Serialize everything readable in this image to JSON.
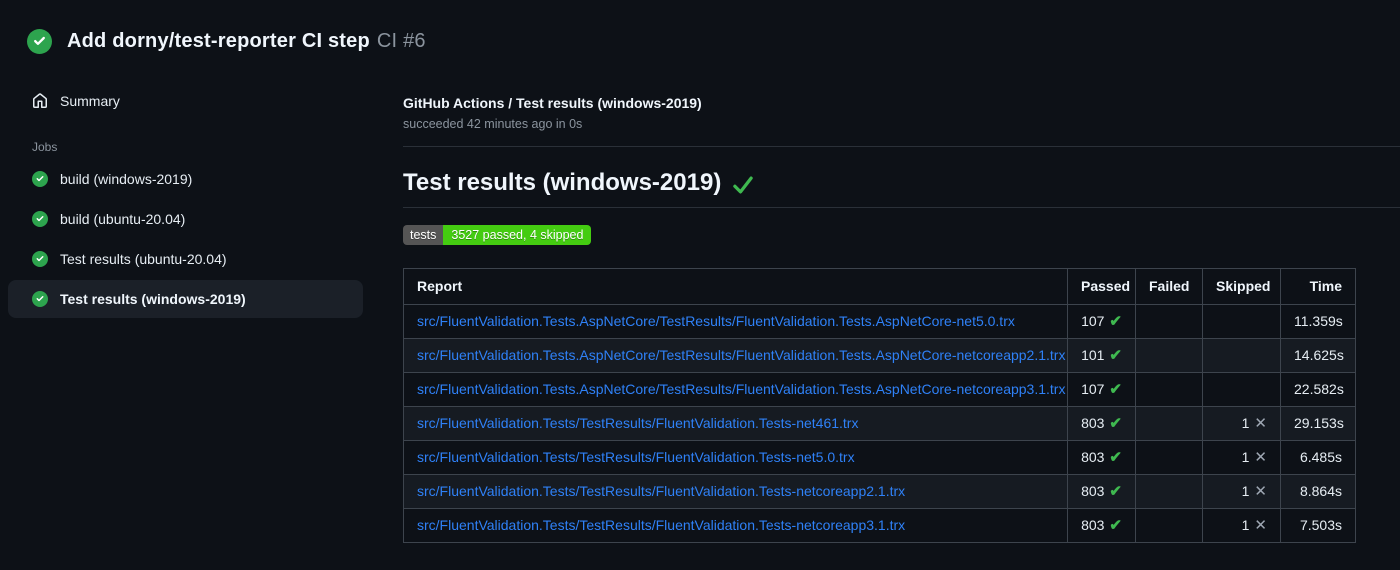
{
  "header": {
    "title": "Add dorny/test-reporter CI step",
    "run_number": "CI #6",
    "status_icon": "check-circle-icon"
  },
  "sidebar": {
    "summary_label": "Summary",
    "summary_icon": "home-icon",
    "jobs_label": "Jobs",
    "job_status_icon": "check-circle-icon",
    "jobs": [
      {
        "label": "build (windows-2019)",
        "selected": false
      },
      {
        "label": "build (ubuntu-20.04)",
        "selected": false
      },
      {
        "label": "Test results (ubuntu-20.04)",
        "selected": false
      },
      {
        "label": "Test results (windows-2019)",
        "selected": true
      }
    ]
  },
  "main": {
    "run_title": "GitHub Actions / Test results (windows-2019)",
    "run_status": "succeeded 42 minutes ago in 0s",
    "section_heading": "Test results (windows-2019)",
    "section_status_icon": "success-check-icon",
    "badge": {
      "label": "tests",
      "value": "3527 passed, 4 skipped",
      "label_bg": "#555555",
      "value_bg": "#44cc11"
    },
    "table": {
      "headers": [
        "Report",
        "Passed",
        "Failed",
        "Skipped",
        "Time"
      ],
      "passed_icon": "check-icon",
      "skipped_icon": "x-icon",
      "rows": [
        {
          "report": "src/FluentValidation.Tests.AspNetCore/TestResults/FluentValidation.Tests.AspNetCore-net5.0.trx",
          "passed": "107",
          "failed": "",
          "skipped": "",
          "time": "11.359s"
        },
        {
          "report": "src/FluentValidation.Tests.AspNetCore/TestResults/FluentValidation.Tests.AspNetCore-netcoreapp2.1.trx",
          "passed": "101",
          "failed": "",
          "skipped": "",
          "time": "14.625s"
        },
        {
          "report": "src/FluentValidation.Tests.AspNetCore/TestResults/FluentValidation.Tests.AspNetCore-netcoreapp3.1.trx",
          "passed": "107",
          "failed": "",
          "skipped": "",
          "time": "22.582s"
        },
        {
          "report": "src/FluentValidation.Tests/TestResults/FluentValidation.Tests-net461.trx",
          "passed": "803",
          "failed": "",
          "skipped": "1",
          "time": "29.153s"
        },
        {
          "report": "src/FluentValidation.Tests/TestResults/FluentValidation.Tests-net5.0.trx",
          "passed": "803",
          "failed": "",
          "skipped": "1",
          "time": "6.485s"
        },
        {
          "report": "src/FluentValidation.Tests/TestResults/FluentValidation.Tests-netcoreapp2.1.trx",
          "passed": "803",
          "failed": "",
          "skipped": "1",
          "time": "8.864s"
        },
        {
          "report": "src/FluentValidation.Tests/TestResults/FluentValidation.Tests-netcoreapp3.1.trx",
          "passed": "803",
          "failed": "",
          "skipped": "1",
          "time": "7.503s"
        }
      ]
    }
  },
  "colors": {
    "bg": "#0d1117",
    "text": "#e6edf3",
    "text-bright": "#f0f6fc",
    "muted": "#8b949e",
    "link": "#2f81f7",
    "green-circle": "#2da44e",
    "green-check": "#3fb950",
    "x-gray": "#9ea7b3",
    "border": "#3d444d",
    "divider": "#2a3038",
    "stripe": "#161b22",
    "selected-bg": "#1b2028",
    "badge-label-bg": "#555555",
    "badge-value-bg": "#44cc11"
  }
}
